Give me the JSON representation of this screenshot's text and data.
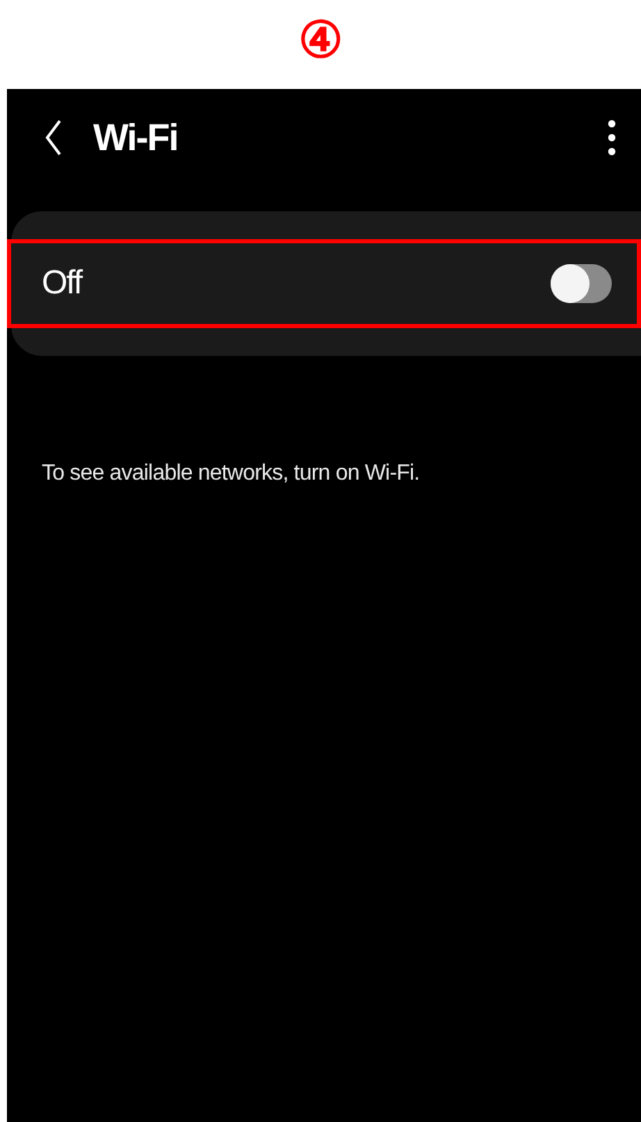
{
  "annotation": {
    "step": "④"
  },
  "header": {
    "title": "Wi-Fi"
  },
  "wifi_switch": {
    "label": "Off",
    "on": false,
    "highlighted": true
  },
  "message": "To see available networks, turn on Wi-Fi."
}
